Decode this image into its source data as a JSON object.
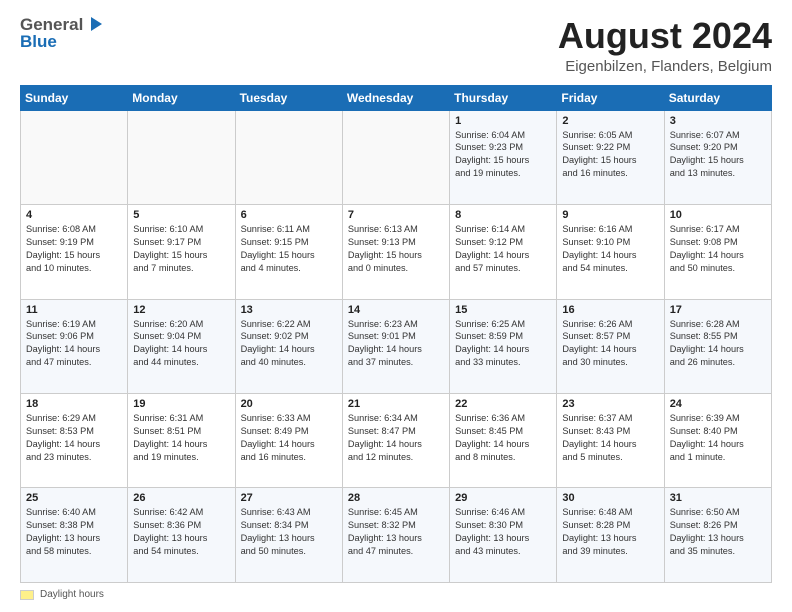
{
  "header": {
    "logo_general": "General",
    "logo_blue": "Blue",
    "main_title": "August 2024",
    "subtitle": "Eigenbilzen, Flanders, Belgium"
  },
  "calendar": {
    "days_of_week": [
      "Sunday",
      "Monday",
      "Tuesday",
      "Wednesday",
      "Thursday",
      "Friday",
      "Saturday"
    ],
    "weeks": [
      [
        {
          "day": "",
          "info": ""
        },
        {
          "day": "",
          "info": ""
        },
        {
          "day": "",
          "info": ""
        },
        {
          "day": "",
          "info": ""
        },
        {
          "day": "1",
          "info": "Sunrise: 6:04 AM\nSunset: 9:23 PM\nDaylight: 15 hours\nand 19 minutes."
        },
        {
          "day": "2",
          "info": "Sunrise: 6:05 AM\nSunset: 9:22 PM\nDaylight: 15 hours\nand 16 minutes."
        },
        {
          "day": "3",
          "info": "Sunrise: 6:07 AM\nSunset: 9:20 PM\nDaylight: 15 hours\nand 13 minutes."
        }
      ],
      [
        {
          "day": "4",
          "info": "Sunrise: 6:08 AM\nSunset: 9:19 PM\nDaylight: 15 hours\nand 10 minutes."
        },
        {
          "day": "5",
          "info": "Sunrise: 6:10 AM\nSunset: 9:17 PM\nDaylight: 15 hours\nand 7 minutes."
        },
        {
          "day": "6",
          "info": "Sunrise: 6:11 AM\nSunset: 9:15 PM\nDaylight: 15 hours\nand 4 minutes."
        },
        {
          "day": "7",
          "info": "Sunrise: 6:13 AM\nSunset: 9:13 PM\nDaylight: 15 hours\nand 0 minutes."
        },
        {
          "day": "8",
          "info": "Sunrise: 6:14 AM\nSunset: 9:12 PM\nDaylight: 14 hours\nand 57 minutes."
        },
        {
          "day": "9",
          "info": "Sunrise: 6:16 AM\nSunset: 9:10 PM\nDaylight: 14 hours\nand 54 minutes."
        },
        {
          "day": "10",
          "info": "Sunrise: 6:17 AM\nSunset: 9:08 PM\nDaylight: 14 hours\nand 50 minutes."
        }
      ],
      [
        {
          "day": "11",
          "info": "Sunrise: 6:19 AM\nSunset: 9:06 PM\nDaylight: 14 hours\nand 47 minutes."
        },
        {
          "day": "12",
          "info": "Sunrise: 6:20 AM\nSunset: 9:04 PM\nDaylight: 14 hours\nand 44 minutes."
        },
        {
          "day": "13",
          "info": "Sunrise: 6:22 AM\nSunset: 9:02 PM\nDaylight: 14 hours\nand 40 minutes."
        },
        {
          "day": "14",
          "info": "Sunrise: 6:23 AM\nSunset: 9:01 PM\nDaylight: 14 hours\nand 37 minutes."
        },
        {
          "day": "15",
          "info": "Sunrise: 6:25 AM\nSunset: 8:59 PM\nDaylight: 14 hours\nand 33 minutes."
        },
        {
          "day": "16",
          "info": "Sunrise: 6:26 AM\nSunset: 8:57 PM\nDaylight: 14 hours\nand 30 minutes."
        },
        {
          "day": "17",
          "info": "Sunrise: 6:28 AM\nSunset: 8:55 PM\nDaylight: 14 hours\nand 26 minutes."
        }
      ],
      [
        {
          "day": "18",
          "info": "Sunrise: 6:29 AM\nSunset: 8:53 PM\nDaylight: 14 hours\nand 23 minutes."
        },
        {
          "day": "19",
          "info": "Sunrise: 6:31 AM\nSunset: 8:51 PM\nDaylight: 14 hours\nand 19 minutes."
        },
        {
          "day": "20",
          "info": "Sunrise: 6:33 AM\nSunset: 8:49 PM\nDaylight: 14 hours\nand 16 minutes."
        },
        {
          "day": "21",
          "info": "Sunrise: 6:34 AM\nSunset: 8:47 PM\nDaylight: 14 hours\nand 12 minutes."
        },
        {
          "day": "22",
          "info": "Sunrise: 6:36 AM\nSunset: 8:45 PM\nDaylight: 14 hours\nand 8 minutes."
        },
        {
          "day": "23",
          "info": "Sunrise: 6:37 AM\nSunset: 8:43 PM\nDaylight: 14 hours\nand 5 minutes."
        },
        {
          "day": "24",
          "info": "Sunrise: 6:39 AM\nSunset: 8:40 PM\nDaylight: 14 hours\nand 1 minute."
        }
      ],
      [
        {
          "day": "25",
          "info": "Sunrise: 6:40 AM\nSunset: 8:38 PM\nDaylight: 13 hours\nand 58 minutes."
        },
        {
          "day": "26",
          "info": "Sunrise: 6:42 AM\nSunset: 8:36 PM\nDaylight: 13 hours\nand 54 minutes."
        },
        {
          "day": "27",
          "info": "Sunrise: 6:43 AM\nSunset: 8:34 PM\nDaylight: 13 hours\nand 50 minutes."
        },
        {
          "day": "28",
          "info": "Sunrise: 6:45 AM\nSunset: 8:32 PM\nDaylight: 13 hours\nand 47 minutes."
        },
        {
          "day": "29",
          "info": "Sunrise: 6:46 AM\nSunset: 8:30 PM\nDaylight: 13 hours\nand 43 minutes."
        },
        {
          "day": "30",
          "info": "Sunrise: 6:48 AM\nSunset: 8:28 PM\nDaylight: 13 hours\nand 39 minutes."
        },
        {
          "day": "31",
          "info": "Sunrise: 6:50 AM\nSunset: 8:26 PM\nDaylight: 13 hours\nand 35 minutes."
        }
      ]
    ]
  },
  "footer": {
    "legend_label": "Daylight hours"
  }
}
